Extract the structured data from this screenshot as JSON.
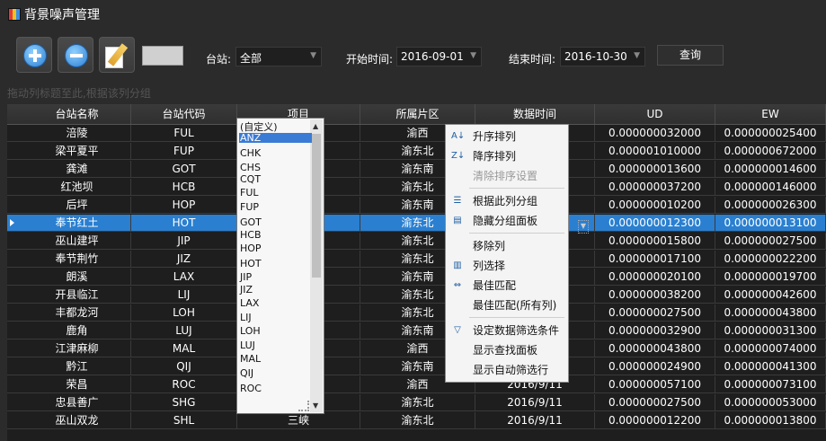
{
  "window": {
    "title": "背景噪声管理"
  },
  "toolbar": {
    "station_label": "台站:",
    "station_value": "全部",
    "start_label": "开始时间:",
    "start_value": "2016-09-01",
    "end_label": "结束时间:",
    "end_value": "2016-10-30",
    "query_label": "查询"
  },
  "group_panel": {
    "hint": "拖动列标题至此,根据该列分组"
  },
  "grid": {
    "columns": [
      "台站名称",
      "台站代码",
      "项目",
      "所属片区",
      "数据时间",
      "UD",
      "EW"
    ],
    "rows": [
      [
        "涪陵",
        "FUL",
        "",
        "渝西",
        "",
        "0.000000032000",
        "0.000000025400"
      ],
      [
        "梁平夏平",
        "FUP",
        "",
        "渝东北",
        "",
        "0.000001010000",
        "0.000000672000"
      ],
      [
        "龚滩",
        "GOT",
        "",
        "渝东南",
        "",
        "0.000000013600",
        "0.000000014600"
      ],
      [
        "红池坝",
        "HCB",
        "",
        "渝东北",
        "",
        "0.000000037200",
        "0.000000146000"
      ],
      [
        "后坪",
        "HOP",
        "",
        "渝东南",
        "",
        "0.000000010200",
        "0.000000026300"
      ],
      [
        "奉节红土",
        "HOT",
        "",
        "渝东北",
        "",
        "0.000000012300",
        "0.000000013100"
      ],
      [
        "巫山建坪",
        "JIP",
        "",
        "渝东北",
        "",
        "0.000000015800",
        "0.000000027500"
      ],
      [
        "奉节荆竹",
        "JIZ",
        "",
        "渝东北",
        "",
        "0.000000017100",
        "0.000000022200"
      ],
      [
        "朗溪",
        "LAX",
        "",
        "渝东南",
        "",
        "0.000000020100",
        "0.000000019700"
      ],
      [
        "开县临江",
        "LIJ",
        "",
        "渝东北",
        "",
        "0.000000038200",
        "0.000000042600"
      ],
      [
        "丰都龙河",
        "LOH",
        "",
        "渝东北",
        "",
        "0.000000027500",
        "0.000000043800"
      ],
      [
        "鹿角",
        "LUJ",
        "",
        "渝东南",
        "",
        "0.000000032900",
        "0.000000031300"
      ],
      [
        "江津麻柳",
        "MAL",
        "",
        "渝西",
        "",
        "0.000000043800",
        "0.000000074000"
      ],
      [
        "黔江",
        "QIJ",
        "",
        "渝东南",
        "",
        "0.000000024900",
        "0.000000041300"
      ],
      [
        "荣昌",
        "ROC",
        "",
        "渝西",
        "2016/9/11",
        "0.000000057100",
        "0.000000073100"
      ],
      [
        "忠县善广",
        "SHG",
        "",
        "渝东北",
        "2016/9/11",
        "0.000000027500",
        "0.000000053000"
      ],
      [
        "巫山双龙",
        "SHL",
        "三峡",
        "渝东北",
        "2016/9/11",
        "0.000000012200",
        "0.000000013800"
      ]
    ]
  },
  "filter_list": {
    "items": [
      "(自定义)",
      "ANZ",
      "CHK",
      "CHS",
      "CQT",
      "FUL",
      "FUP",
      "GOT",
      "HCB",
      "HOP",
      "HOT",
      "JIP",
      "JIZ",
      "LAX",
      "LIJ",
      "LOH",
      "LUJ",
      "MAL",
      "QIJ",
      "ROC"
    ],
    "selected": "ANZ"
  },
  "context_menu": {
    "items": [
      {
        "label": "升序排列",
        "icon": "sort-ascending-icon",
        "disabled": false
      },
      {
        "label": "降序排列",
        "icon": "sort-descending-icon",
        "disabled": false
      },
      {
        "label": "清除排序设置",
        "icon": "",
        "disabled": true
      },
      {
        "label": "根据此列分组",
        "icon": "group-by-icon",
        "disabled": false
      },
      {
        "label": "隐藏分组面板",
        "icon": "group-panel-icon",
        "disabled": false
      },
      {
        "label": "移除列",
        "icon": "",
        "disabled": false
      },
      {
        "label": "列选择",
        "icon": "column-chooser-icon",
        "disabled": false
      },
      {
        "label": "最佳匹配",
        "icon": "best-fit-icon",
        "disabled": false
      },
      {
        "label": "最佳匹配(所有列)",
        "icon": "",
        "disabled": false
      },
      {
        "label": "设定数据筛选条件",
        "icon": "filter-icon",
        "disabled": false
      },
      {
        "label": "显示查找面板",
        "icon": "",
        "disabled": false
      },
      {
        "label": "显示自动筛选行",
        "icon": "",
        "disabled": false
      }
    ]
  },
  "colors": {
    "selected_row": "#2a7fd0",
    "background": "#2b2b2b",
    "grid": "#1e1e1e"
  }
}
